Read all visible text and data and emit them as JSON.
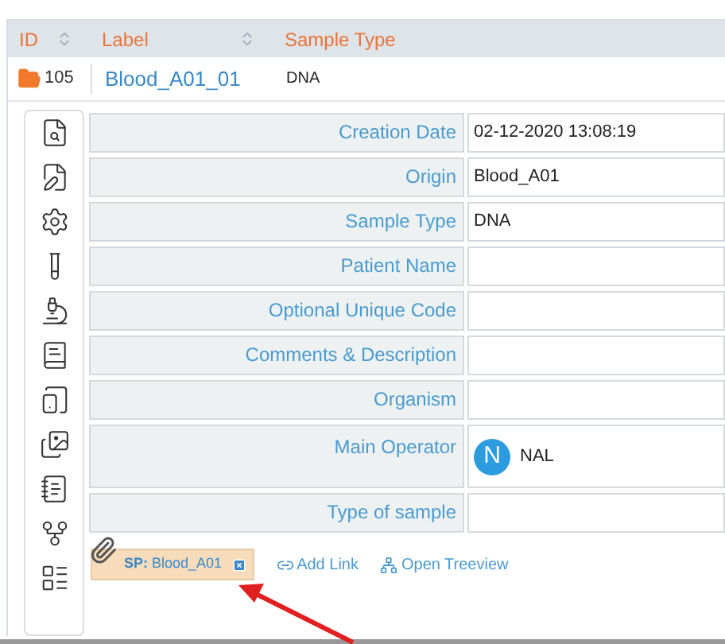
{
  "table": {
    "columns": [
      {
        "label": "ID",
        "sortable": true
      },
      {
        "label": "Label",
        "sortable": true
      },
      {
        "label": "Sample Type",
        "sortable": false
      }
    ],
    "row": {
      "id": "105",
      "label": "Blood_A01_01",
      "sample_type": "DNA"
    }
  },
  "sidebar": {
    "items": [
      {
        "kind": "search"
      },
      {
        "kind": "edit"
      },
      {
        "kind": "settings"
      },
      {
        "kind": "tube"
      },
      {
        "kind": "microscope"
      },
      {
        "kind": "book"
      },
      {
        "kind": "tablet"
      },
      {
        "kind": "photos"
      },
      {
        "kind": "notebook"
      },
      {
        "kind": "branch"
      },
      {
        "kind": "layout"
      }
    ]
  },
  "fields": [
    {
      "kind": "text",
      "label": "Creation Date",
      "value": "02-12-2020 13:08:19"
    },
    {
      "kind": "text",
      "label": "Origin",
      "value": "Blood_A01"
    },
    {
      "kind": "text",
      "label": "Sample Type",
      "value": "DNA"
    },
    {
      "kind": "text",
      "label": "Patient Name"
    },
    {
      "kind": "text",
      "label": "Optional Unique Code"
    },
    {
      "kind": "text",
      "label": "Comments & Description"
    },
    {
      "kind": "text",
      "label": "Organism"
    },
    {
      "kind": "user",
      "label": "Main Operator",
      "initial": "N",
      "value": "NAL"
    },
    {
      "kind": "text",
      "label": "Type of sample"
    }
  ],
  "attachment": {
    "tag": "**SP:** Blood_A01"
  },
  "links": [
    {
      "kind": "link",
      "label": "Add Link"
    },
    {
      "kind": "tree",
      "label": "Open Treeview"
    }
  ]
}
